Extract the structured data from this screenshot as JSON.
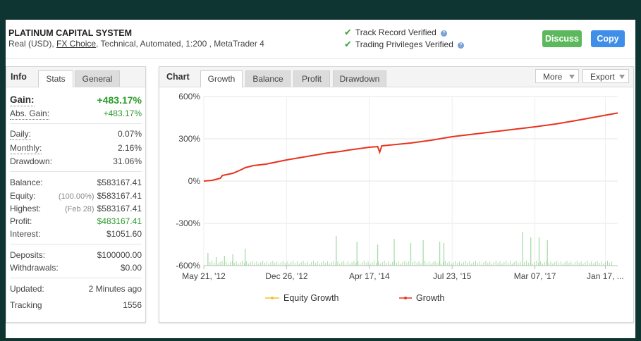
{
  "system": {
    "title": "PLATINUM CAPITAL SYSTEM",
    "sub_prefix": "Real (USD), ",
    "sub_link": "FX Choice",
    "sub_suffix": ", Technical, Automated, 1:200 , MetaTrader 4"
  },
  "verification": {
    "track_record": "Track Record Verified",
    "trading_privileges": "Trading Privileges Verified"
  },
  "buttons": {
    "discuss": "Discuss",
    "copy": "Copy"
  },
  "info_panel": {
    "title": "Info",
    "tabs": [
      "Stats",
      "General"
    ],
    "gain": {
      "label": "Gain:",
      "value": "+483.17%"
    },
    "abs_gain": {
      "label": "Abs. Gain:",
      "value": "+483.17%"
    },
    "daily": {
      "label": "Daily:",
      "value": "0.07%"
    },
    "monthly": {
      "label": "Monthly:",
      "value": "2.16%"
    },
    "drawdown": {
      "label": "Drawdown:",
      "value": "31.06%"
    },
    "balance": {
      "label": "Balance:",
      "value": "$583167.41"
    },
    "equity": {
      "label": "Equity:",
      "prefix": "(100.00%)",
      "value": "$583167.41"
    },
    "highest": {
      "label": "Highest:",
      "prefix": "(Feb 28)",
      "value": "$583167.41"
    },
    "profit": {
      "label": "Profit:",
      "value": "$483167.41"
    },
    "interest": {
      "label": "Interest:",
      "value": "$1051.60"
    },
    "deposits": {
      "label": "Deposits:",
      "value": "$100000.00"
    },
    "withdrawals": {
      "label": "Withdrawals:",
      "value": "$0.00"
    },
    "updated": {
      "label": "Updated:",
      "value": "2 Minutes ago"
    },
    "tracking": {
      "label": "Tracking",
      "value": "1556"
    }
  },
  "chart_panel": {
    "title": "Chart",
    "tabs": [
      "Growth",
      "Balance",
      "Profit",
      "Drawdown"
    ],
    "active_tab": "Growth",
    "more_label": "More",
    "export_label": "Export"
  },
  "colors": {
    "growth": "#e8321e",
    "equity": "#f2c12e",
    "bars": "#a8dca8",
    "gain_green": "#2b9b2b"
  },
  "chart_data": {
    "type": "line",
    "ylim": [
      -600,
      600
    ],
    "y_ticks": [
      600,
      300,
      0,
      -300,
      -600
    ],
    "y_tick_labels": [
      "600%",
      "300%",
      "0%",
      "-300%",
      "-600%"
    ],
    "x_tick_labels": [
      "May 21, '12",
      "Dec 26, '12",
      "Apr 17, '14",
      "Jul 23, '15",
      "Mar 07, '17",
      "Jan 17, ..."
    ],
    "x_tick_fracs": [
      0.0,
      0.2,
      0.4,
      0.6,
      0.8,
      0.97
    ],
    "series": [
      {
        "name": "Equity Growth",
        "x": [
          0.0,
          1.0
        ],
        "y": [
          0,
          483.17
        ]
      },
      {
        "name": "Growth",
        "x": [
          0.0,
          0.02,
          0.04,
          0.045,
          0.07,
          0.09,
          0.1,
          0.12,
          0.15,
          0.2,
          0.25,
          0.3,
          0.33,
          0.35,
          0.4,
          0.42,
          0.425,
          0.43,
          0.5,
          0.55,
          0.6,
          0.7,
          0.8,
          0.85,
          0.9,
          1.0
        ],
        "y": [
          0,
          5,
          20,
          40,
          55,
          80,
          95,
          110,
          120,
          150,
          175,
          200,
          210,
          220,
          240,
          245,
          205,
          250,
          270,
          290,
          315,
          350,
          385,
          405,
          430,
          483.17
        ]
      }
    ],
    "bars_note": "",
    "legend": [
      "Equity Growth",
      "Growth"
    ],
    "legend_position": "bottom"
  }
}
